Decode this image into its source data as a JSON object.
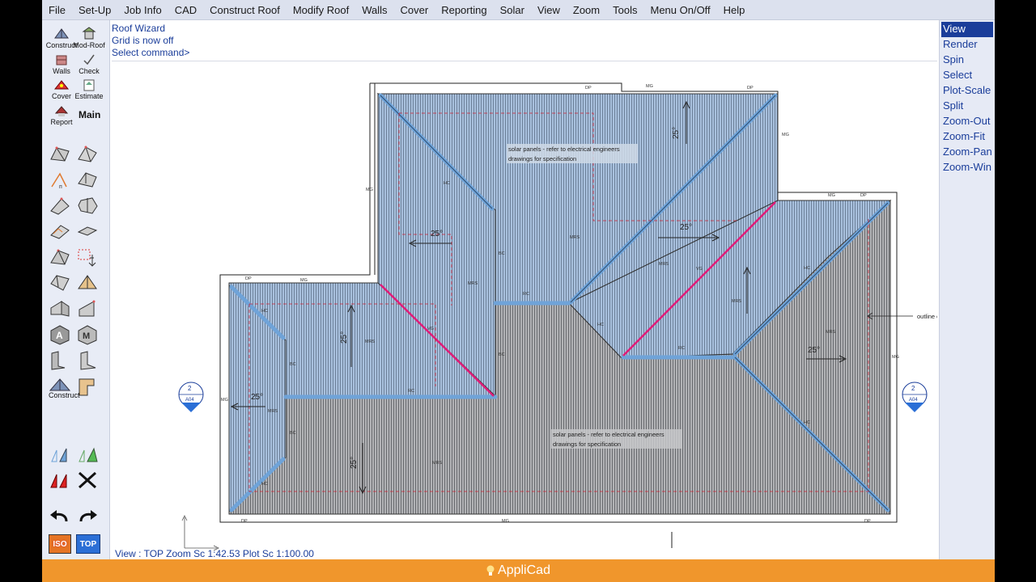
{
  "menu": {
    "items": [
      "File",
      "Set-Up",
      "Job Info",
      "CAD",
      "Construct Roof",
      "Modify Roof",
      "Walls",
      "Cover",
      "Reporting",
      "Solar",
      "View",
      "Zoom",
      "Tools",
      "Menu On/Off",
      "Help"
    ]
  },
  "toolbar": {
    "construct_label": "Construct",
    "modroof_label": "Mod-Roof",
    "walls_label": "Walls",
    "check_label": "Check",
    "cover_label": "Cover",
    "estimate_label": "Estimate",
    "report_label": "Report",
    "main_label": "Main",
    "construct2_label": "Construct",
    "iso_label": "ISO",
    "top_label": "TOP"
  },
  "command": {
    "lines": [
      "Roof Wizard",
      "Grid is now off",
      "Select command>"
    ]
  },
  "status": {
    "text": "View : TOP  Zoom Sc 1:42.53  Plot Sc 1:100.00"
  },
  "right_panel": {
    "items": [
      "View",
      "Render",
      "Spin",
      "Select",
      "Plot-Scale",
      "Split",
      "Zoom-Out",
      "Zoom-Fit",
      "Zoom-Pan",
      "Zoom-Win"
    ],
    "active_index": 0
  },
  "drawing": {
    "note_1": "solar panels - refer to electrical engineers",
    "note_1b": "drawings for specification",
    "note_2": "solar panels - refer to electrical engineers",
    "note_2b": "drawings for specification",
    "outline_note": "outline of",
    "pitch_label": "25°",
    "section_top": "2",
    "section_bottom": "A04",
    "labels": {
      "dp": "DP",
      "mg": "MG",
      "hc": "HC",
      "bc": "BC",
      "vg": "VG",
      "rc": "RC",
      "mrs": "MRS"
    }
  },
  "brand": {
    "name": "AppliCad"
  },
  "colors": {
    "menubar": "#dce1ee",
    "roof_blue": "#9fb8d6",
    "roof_grey": "#a7a9ad",
    "hip_blue": "#6fa3d8",
    "valley_magenta": "#e01c78",
    "brand_orange": "#f0962c",
    "command_text": "#1a3d9a"
  }
}
